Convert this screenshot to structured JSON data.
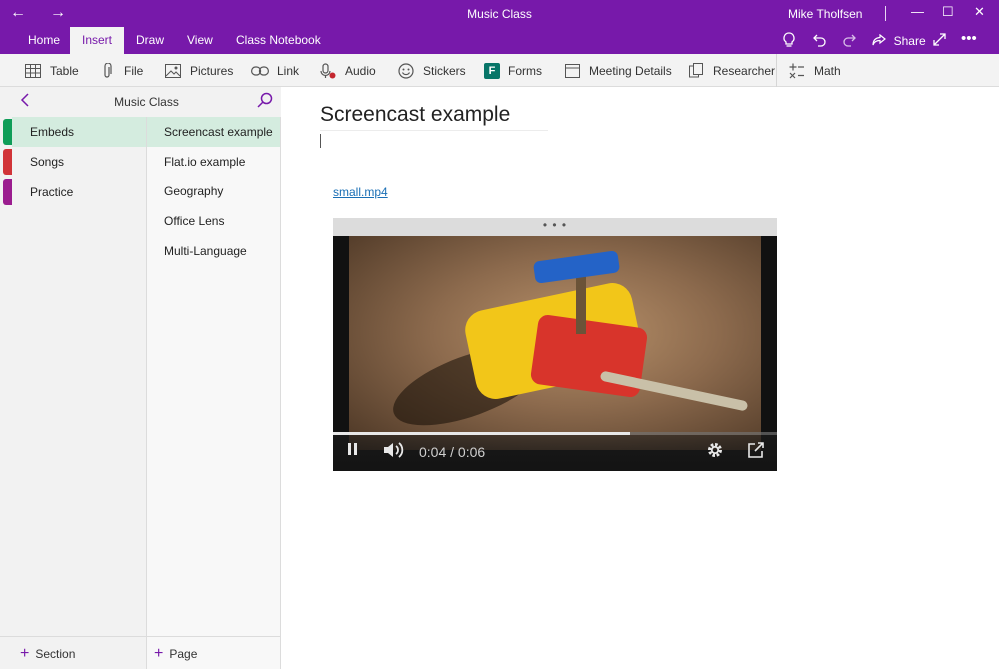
{
  "titlebar": {
    "title": "Music Class",
    "user": "Mike Tholfsen",
    "back_glyph": "←",
    "forward_glyph": "→",
    "minimize_glyph": "—",
    "maximize_glyph": "☐",
    "close_glyph": "✕"
  },
  "ribbon": {
    "tabs": [
      {
        "label": "Home"
      },
      {
        "label": "Insert"
      },
      {
        "label": "Draw"
      },
      {
        "label": "View"
      },
      {
        "label": "Class Notebook"
      }
    ],
    "active_tab": "Insert",
    "share_label": "Share",
    "accent_color": "#7719aa",
    "icons": [
      "lightbulb-icon",
      "undo-icon",
      "redo-icon",
      "share-icon",
      "expand-icon",
      "more-icon"
    ]
  },
  "toolbar": {
    "items": [
      {
        "label": "Table",
        "icon": "table-icon"
      },
      {
        "label": "File",
        "icon": "paperclip-icon"
      },
      {
        "label": "Pictures",
        "icon": "picture-icon"
      },
      {
        "label": "Link",
        "icon": "link-icon"
      },
      {
        "label": "Audio",
        "icon": "microphone-icon"
      },
      {
        "label": "Stickers",
        "icon": "smiley-icon"
      },
      {
        "label": "Forms",
        "icon": "forms-icon"
      },
      {
        "label": "Meeting Details",
        "icon": "calendar-icon"
      },
      {
        "label": "Researcher",
        "icon": "researcher-icon"
      },
      {
        "label": "Math",
        "icon": "math-icon"
      }
    ],
    "forms_glyph": "F"
  },
  "notebook": {
    "name": "Music Class"
  },
  "sections": [
    {
      "label": "Embeds",
      "color": "#0f9d58",
      "active": true
    },
    {
      "label": "Songs",
      "color": "#d13438",
      "active": false
    },
    {
      "label": "Practice",
      "color": "#9b1d8f",
      "active": false
    }
  ],
  "pages": [
    {
      "label": "Screencast example",
      "active": true
    },
    {
      "label": "Flat.io example",
      "active": false
    },
    {
      "label": "Geography",
      "active": false
    },
    {
      "label": "Office Lens",
      "active": false
    },
    {
      "label": "Multi-Language",
      "active": false
    }
  ],
  "add": {
    "section_label": "Section",
    "page_label": "Page"
  },
  "canvas": {
    "page_title": "Screencast example",
    "file_link": "small.mp4"
  },
  "video": {
    "grip": "• • •",
    "time": "0:04 / 0:06",
    "progress": 0.67
  }
}
